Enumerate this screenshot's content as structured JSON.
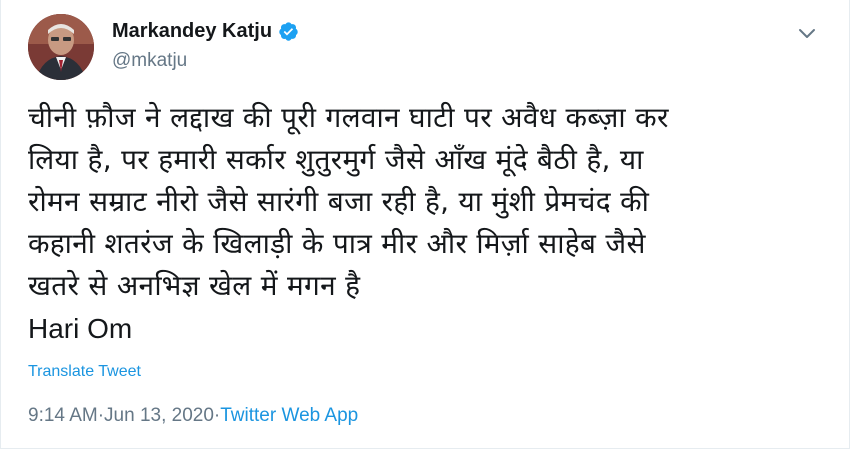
{
  "author": {
    "name": "Markandey Katju",
    "handle": "@mkatju",
    "verified": true
  },
  "tweet": {
    "text": "चीनी फ़ौज ने लद्दाख की पूरी गलवान घाटी पर अवैध कब्ज़ा कर\nलिया है, पर हमारी सर्कार शुतुरमुर्ग जैसे आँख मूंदे बैठी है, या\nरोमन सम्राट नीरो जैसे सारंगी बजा रही है, या मुंशी प्रेमचंद की\nकहानी शतरंज के खिलाड़ी के पात्र मीर और मिर्ज़ा साहेब जैसे\nखतरे से अनभिज्ञ खेल में मगन है",
    "signoff": "Hari Om",
    "translate_label": "Translate Tweet",
    "time": "9:14 AM",
    "date": "Jun 13, 2020",
    "separator": " · ",
    "source": "Twitter Web App"
  },
  "colors": {
    "accent": "#1b95e0",
    "secondary_text": "#657786",
    "primary_text": "#14171a"
  },
  "icons": {
    "verified": "verified-badge-icon",
    "caret": "chevron-down-icon"
  }
}
